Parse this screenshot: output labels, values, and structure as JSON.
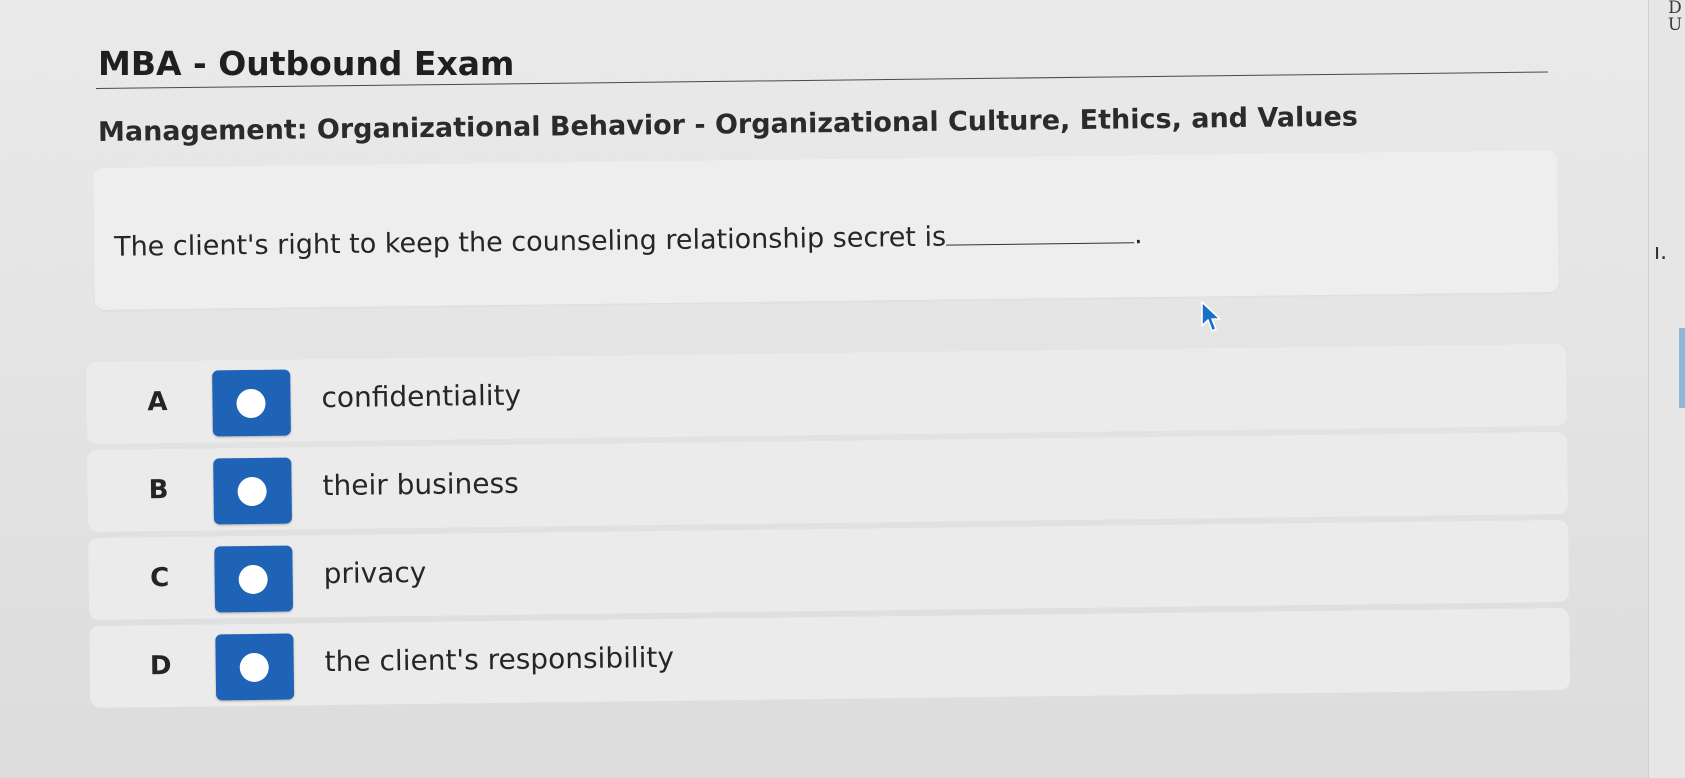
{
  "exam": {
    "title": "MBA - Outbound Exam"
  },
  "section": {
    "heading": "Management: Organizational Behavior - Organizational Culture, Ethics, and Values"
  },
  "question": {
    "text": "The client's right to keep the counseling relationship secret is",
    "ending": "."
  },
  "options": [
    {
      "letter": "A",
      "text": "confidentiality"
    },
    {
      "letter": "B",
      "text": "their business"
    },
    {
      "letter": "C",
      "text": "privacy"
    },
    {
      "letter": "D",
      "text": "the client's responsibility"
    }
  ],
  "right_panel": {
    "top_text_1": "D",
    "top_text_2": "U",
    "side_text": "ı."
  },
  "colors": {
    "radio_tile": "#1e63b6",
    "background": "#e6e6e6"
  }
}
